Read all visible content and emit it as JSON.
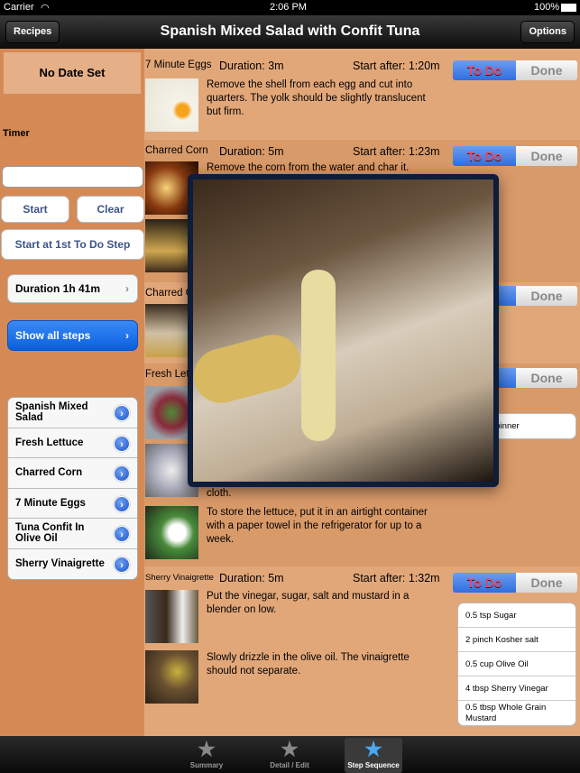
{
  "status": {
    "carrier": "Carrier",
    "time": "2:06 PM",
    "battery": "100%"
  },
  "nav": {
    "back": "Recipes",
    "title": "Spanish Mixed Salad with Confit Tuna",
    "options": "Options"
  },
  "left": {
    "date": "No Date Set",
    "timer_label": "Timer",
    "timer_value": "",
    "start": "Start",
    "clear": "Clear",
    "start_first": "Start at 1st To Do Step",
    "duration": "Duration 1h 41m",
    "show_all": "Show all steps",
    "recipes": [
      "Spanish Mixed Salad",
      "Fresh Lettuce",
      "Charred Corn",
      "7 Minute Eggs",
      "Tuna Confit In Olive Oil",
      "Sherry Vinaigrette"
    ]
  },
  "steps": [
    {
      "name": "7 Minute Eggs",
      "duration": "Duration: 3m",
      "start": "Start after: 1:20m",
      "todo": "To Do",
      "done": "Done",
      "text": "Remove the shell from each egg and cut into quarters. The yolk should be slightly translucent but firm."
    },
    {
      "name": "Charred Corn",
      "duration": "Duration: 5m",
      "start": "Start after: 1:23m",
      "todo": "To Do",
      "done": "Done",
      "text": "Remove the corn from the water and char it."
    },
    {
      "name": "Charred Corn",
      "done": "Done"
    },
    {
      "name": "Fresh Lettuce",
      "done": "Done",
      "ingredient_partial": "Salad Spinner",
      "text_partial": "cloth.",
      "text2": "To store the lettuce, put it in an airtight container with a paper towel in the refrigerator for up to a week."
    },
    {
      "name": "Sherry Vinaigrette",
      "duration": "Duration: 5m",
      "start": "Start after: 1:32m",
      "todo": "To Do",
      "done": "Done",
      "text": "Put the vinegar, sugar, salt and mustard in a blender on low.",
      "text2": "Slowly drizzle in the olive oil. The vinaigrette should not separate.",
      "ingredients": [
        "0.5 tsp Sugar",
        "2 pinch Kosher salt",
        "0.5 cup Olive Oil",
        "4 tbsp Sherry Vinegar",
        "0.5 tbsp Whole Grain Mustard"
      ]
    }
  ],
  "tabs": [
    {
      "label": "Summary",
      "icon": "star-icon"
    },
    {
      "label": "Detail / Edit",
      "icon": "star-icon"
    },
    {
      "label": "Step Sequence",
      "icon": "star-icon",
      "active": true
    }
  ],
  "colors": {
    "accent": "#2f6fe0",
    "todo_text": "#e74b6a",
    "background": "#e2a779"
  }
}
